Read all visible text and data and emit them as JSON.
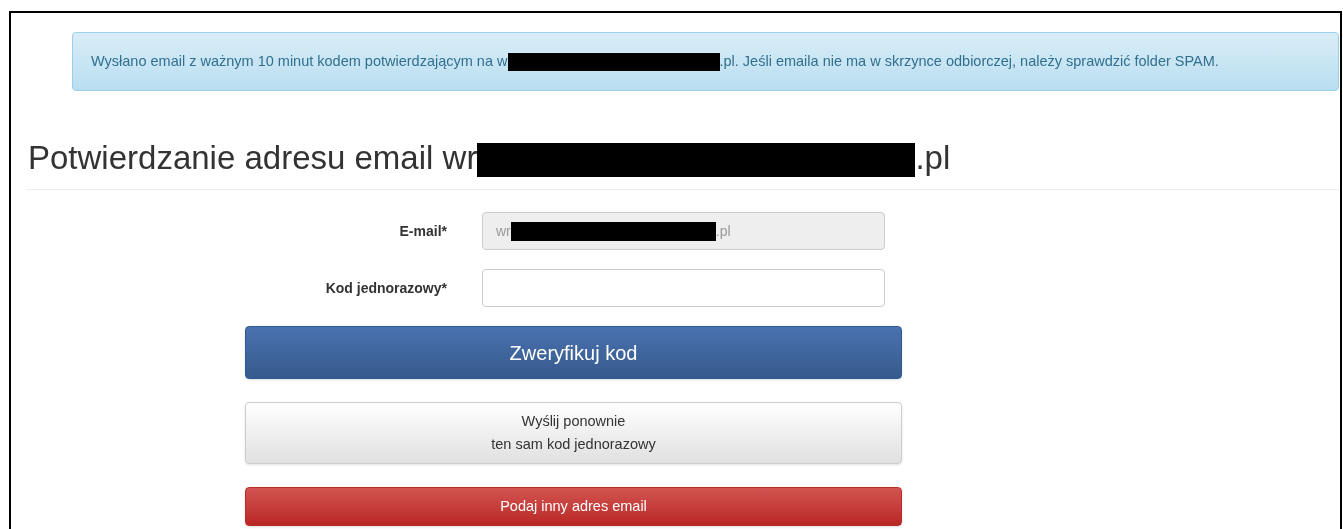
{
  "alert": {
    "text_before": "Wysłano email z ważnym 10 minut kodem potwierdzającym na w",
    "text_after": ".pl. Jeśli emaila nie ma w skrzynce odbiorczej, należy sprawdzić folder SPAM."
  },
  "heading": {
    "text_before": "Potwierdzanie adresu email wr",
    "text_after": ".pl"
  },
  "form": {
    "fields": [
      {
        "label": "E-mail*",
        "value_before": "wr",
        "value_after": ".pl",
        "disabled": true
      },
      {
        "label": "Kod jednorazowy*",
        "disabled": false
      }
    ],
    "buttons": [
      {
        "kind": "primary",
        "lines": [
          "Zweryfikuj kod"
        ]
      },
      {
        "kind": "default",
        "lines": [
          "Wyślij ponownie",
          "ten sam kod jednorazowy"
        ]
      },
      {
        "kind": "danger",
        "lines": [
          "Podaj inny adres email"
        ]
      }
    ]
  }
}
